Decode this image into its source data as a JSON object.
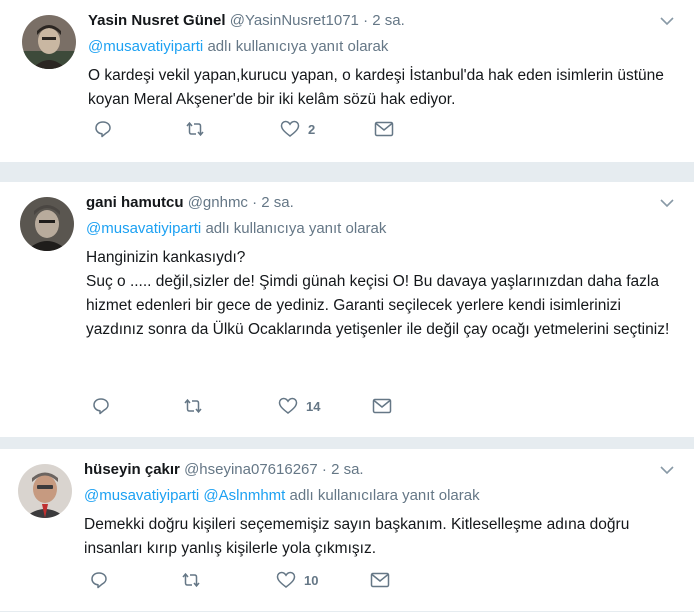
{
  "tweets": [
    {
      "name": "Yasin Nusret Günel",
      "handle": "@YasinNusret1071",
      "dot": "·",
      "time": "2 sa.",
      "mentions": "@musavatiyiparti",
      "reply_suffix": "adlı kullanıcıya yanıt olarak",
      "lines": [
        "O kardeşi vekil yapan,kurucu yapan, o kardeşi İstanbul'da hak eden isimlerin üstüne koyan Meral Akşener'de bir iki kelâm sözü hak ediyor."
      ],
      "likes": "2",
      "avatar_colors": [
        "#7a6f66",
        "#2b2622",
        "#c9b7a2"
      ]
    },
    {
      "name": "gani hamutcu",
      "handle": "@gnhmc",
      "dot": "·",
      "time": "2 sa.",
      "mentions": "@musavatiyiparti",
      "reply_suffix": "adlı kullanıcıya yanıt olarak",
      "lines": [
        "Hanginizin kankasıydı?",
        "Suç o ..... değil,sizler de! Şimdi günah keçisi O! Bu davaya yaşlarınızdan daha fazla hizmet edenleri bir gece de yediniz. Garanti seçilecek yerlere kendi isimlerinizi yazdınız sonra da Ülkü Ocaklarında yetişenler ile değil çay ocağı yetmelerini seçtiniz!"
      ],
      "likes": "14",
      "avatar_colors": [
        "#5a5650",
        "#1f1d1b",
        "#b8ab9c"
      ]
    },
    {
      "name": "hüseyin çakır",
      "handle": "@hseyina07616267",
      "dot": "·",
      "time": "2 sa.",
      "mentions": "@musavatiyiparti @Aslnmhmt",
      "reply_suffix": "adlı kullanıcılara yanıt olarak",
      "lines": [
        "Demekki doğru kişileri seçememişiz sayın başkanım. Kitleselleşme adına doğru insanları kırıp yanlış kişilerle yola çıkmışız."
      ],
      "likes": "10",
      "avatar_colors": [
        "#d9d4cf",
        "#3b3a3c",
        "#c69a80"
      ]
    }
  ],
  "colors": {
    "link": "#1da1f2",
    "secondary": "#657786",
    "text": "#14171a",
    "background": "#e6ecf0"
  },
  "icons": {
    "reply": "reply-icon",
    "retweet": "retweet-icon",
    "like": "heart-icon",
    "dm": "envelope-icon",
    "caret": "chevron-down-icon"
  }
}
